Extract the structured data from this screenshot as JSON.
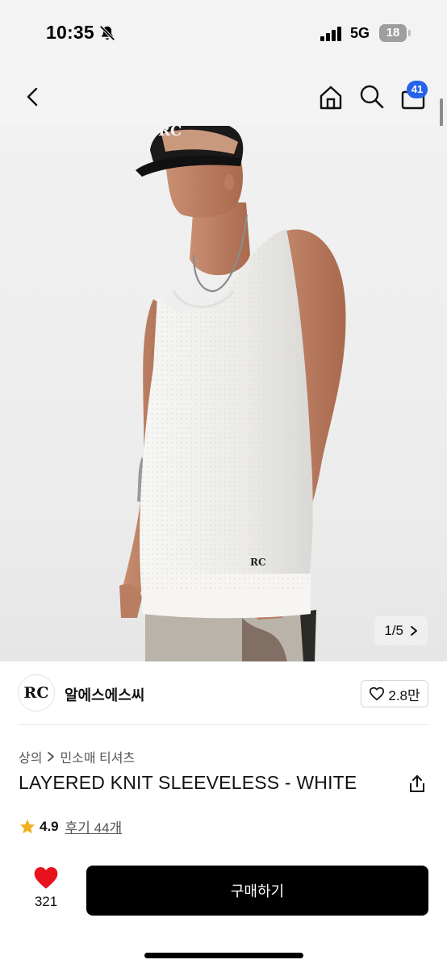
{
  "status_bar": {
    "time": "10:35",
    "network": "5G",
    "battery": "18",
    "icons": [
      "bell-slash-icon",
      "signal-icon"
    ]
  },
  "nav": {
    "cart_count": "41",
    "icons": [
      "chevron-left-icon",
      "home-icon",
      "search-icon",
      "shopping-bag-icon"
    ]
  },
  "image": {
    "counter": "1/5",
    "cap_logo": "RC",
    "shirt_logo": "RC"
  },
  "brand": {
    "logo": "RC",
    "name": "알에스에스씨",
    "likes": "2.8만"
  },
  "product": {
    "category": [
      "상의",
      "민소매 티셔츠"
    ],
    "title": "LAYERED KNIT SLEEVELESS - WHITE",
    "rating": "4.9",
    "reviews": "후기 44개"
  },
  "actions": {
    "wish_count": "321",
    "buy_label": "구매하기"
  },
  "colors": {
    "accent_badge": "#2563eb",
    "heart": "#e8121c",
    "star": "#f2b01e",
    "buy_button": "#000000"
  }
}
